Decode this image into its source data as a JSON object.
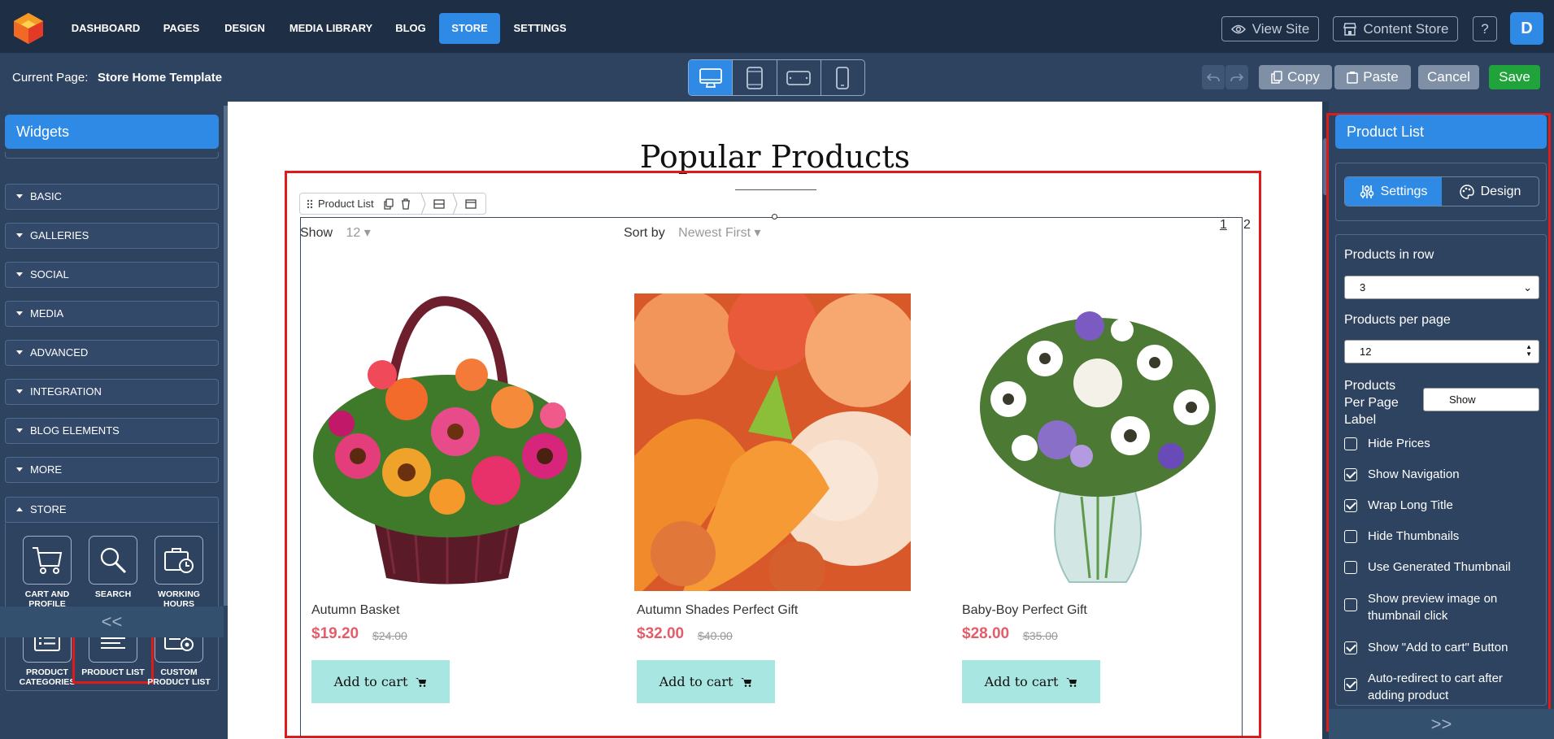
{
  "nav": {
    "items": [
      {
        "label": "DASHBOARD"
      },
      {
        "label": "PAGES"
      },
      {
        "label": "DESIGN"
      },
      {
        "label": "MEDIA LIBRARY"
      },
      {
        "label": "BLOG"
      },
      {
        "label": "STORE",
        "active": true
      },
      {
        "label": "SETTINGS"
      }
    ],
    "view_site": "View Site",
    "content_store": "Content Store",
    "help": "?",
    "avatar_initial": "D"
  },
  "editor": {
    "current_page_label": "Current Page:",
    "current_page_value": "Store Home Template",
    "devices": [
      "desktop",
      "tablet-portrait",
      "tablet-landscape",
      "mobile"
    ],
    "active_device": "desktop",
    "copy": "Copy",
    "paste": "Paste",
    "cancel": "Cancel",
    "save": "Save"
  },
  "sidebar": {
    "header": "Widgets",
    "categories": [
      {
        "label": "BASIC"
      },
      {
        "label": "GALLERIES"
      },
      {
        "label": "SOCIAL"
      },
      {
        "label": "MEDIA"
      },
      {
        "label": "ADVANCED"
      },
      {
        "label": "INTEGRATION"
      },
      {
        "label": "BLOG ELEMENTS"
      },
      {
        "label": "MORE"
      },
      {
        "label": "STORE"
      }
    ],
    "store_widgets": [
      {
        "label": "CART AND PROFILE",
        "icon": "cart-icon"
      },
      {
        "label": "SEARCH",
        "icon": "search-icon"
      },
      {
        "label": "WORKING HOURS",
        "icon": "working-hours-icon"
      },
      {
        "label": "PRODUCT CATEGORIES",
        "icon": "categories-icon"
      },
      {
        "label": "PRODUCT LIST",
        "icon": "product-list-icon"
      },
      {
        "label": "CUSTOM PRODUCT LIST",
        "icon": "custom-list-icon"
      }
    ],
    "collapse": "<<"
  },
  "canvas": {
    "section_title": "Popular Products",
    "widget_toolbar_label": "Product List",
    "show_label": "Show",
    "show_value": "12",
    "sort_label": "Sort by",
    "sort_value": "Newest First",
    "pages": [
      "1",
      "2"
    ],
    "products": [
      {
        "name": "Autumn Basket",
        "price": "$19.20",
        "old_price": "$24.00",
        "button": "Add to cart"
      },
      {
        "name": "Autumn Shades Perfect Gift",
        "price": "$32.00",
        "old_price": "$40.00",
        "button": "Add to cart"
      },
      {
        "name": "Baby-Boy Perfect Gift",
        "price": "$28.00",
        "old_price": "$35.00",
        "button": "Add to cart"
      }
    ]
  },
  "panel": {
    "title": "Product List",
    "tabs": [
      {
        "label": "Settings"
      },
      {
        "label": "Design"
      }
    ],
    "products_in_row_label": "Products in row",
    "products_in_row_value": "3",
    "products_per_page_label": "Products per page",
    "products_per_page_value": "12",
    "per_page_label_label": "Products Per Page Label",
    "per_page_label_value": "Show",
    "checkboxes": [
      {
        "label": "Hide Prices",
        "checked": false
      },
      {
        "label": "Show Navigation",
        "checked": true
      },
      {
        "label": "Wrap Long Title",
        "checked": true
      },
      {
        "label": "Hide Thumbnails",
        "checked": false
      },
      {
        "label": "Use Generated Thumbnail",
        "checked": false
      },
      {
        "label": "Show preview image on thumbnail click",
        "checked": false
      },
      {
        "label": "Show \"Add to cart\" Button",
        "checked": true
      },
      {
        "label": "Auto-redirect to cart after adding product",
        "checked": true
      }
    ],
    "collapse": ">>"
  },
  "colors": {
    "accent": "#2f8ae6",
    "topbar": "#1e2e45",
    "panel": "#2d4360",
    "save": "#1fa33a",
    "price": "#e35d6a",
    "cart_button": "#a8e6e1",
    "selection": "#e01a1a"
  }
}
